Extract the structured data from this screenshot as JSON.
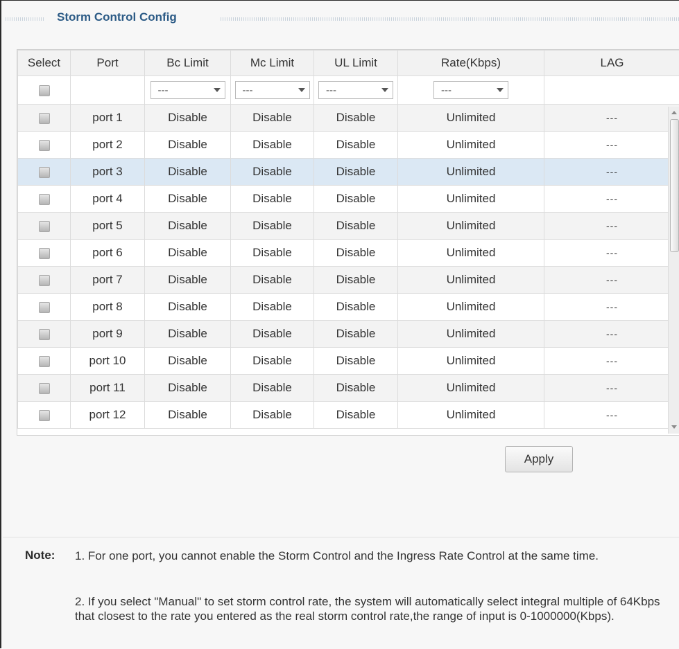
{
  "panel": {
    "title": "Storm Control Config"
  },
  "table": {
    "headers": [
      "Select",
      "Port",
      "Bc Limit",
      "Mc Limit",
      "UL Limit",
      "Rate(Kbps)",
      "LAG"
    ],
    "filter": {
      "bc": "---",
      "mc": "---",
      "ul": "---",
      "rate": "---"
    },
    "rows": [
      {
        "port": "port 1",
        "bc": "Disable",
        "mc": "Disable",
        "ul": "Disable",
        "rate": "Unlimited",
        "lag": "---"
      },
      {
        "port": "port 2",
        "bc": "Disable",
        "mc": "Disable",
        "ul": "Disable",
        "rate": "Unlimited",
        "lag": "---"
      },
      {
        "port": "port 3",
        "bc": "Disable",
        "mc": "Disable",
        "ul": "Disable",
        "rate": "Unlimited",
        "lag": "---"
      },
      {
        "port": "port 4",
        "bc": "Disable",
        "mc": "Disable",
        "ul": "Disable",
        "rate": "Unlimited",
        "lag": "---"
      },
      {
        "port": "port 5",
        "bc": "Disable",
        "mc": "Disable",
        "ul": "Disable",
        "rate": "Unlimited",
        "lag": "---"
      },
      {
        "port": "port 6",
        "bc": "Disable",
        "mc": "Disable",
        "ul": "Disable",
        "rate": "Unlimited",
        "lag": "---"
      },
      {
        "port": "port 7",
        "bc": "Disable",
        "mc": "Disable",
        "ul": "Disable",
        "rate": "Unlimited",
        "lag": "---"
      },
      {
        "port": "port 8",
        "bc": "Disable",
        "mc": "Disable",
        "ul": "Disable",
        "rate": "Unlimited",
        "lag": "---"
      },
      {
        "port": "port 9",
        "bc": "Disable",
        "mc": "Disable",
        "ul": "Disable",
        "rate": "Unlimited",
        "lag": "---"
      },
      {
        "port": "port 10",
        "bc": "Disable",
        "mc": "Disable",
        "ul": "Disable",
        "rate": "Unlimited",
        "lag": "---"
      },
      {
        "port": "port 11",
        "bc": "Disable",
        "mc": "Disable",
        "ul": "Disable",
        "rate": "Unlimited",
        "lag": "---"
      },
      {
        "port": "port 12",
        "bc": "Disable",
        "mc": "Disable",
        "ul": "Disable",
        "rate": "Unlimited",
        "lag": "---"
      }
    ]
  },
  "apply_label": "Apply",
  "note": {
    "label": "Note:",
    "item1": "1. For one port, you cannot enable the Storm Control and the Ingress Rate Control at the same time.",
    "item2": "2. If you select \"Manual\" to set storm control rate, the system will automatically select integral multiple of 64Kbps that closest to the rate you entered as the real storm control rate,the range of input is 0-1000000(Kbps)."
  },
  "colors": {
    "title": "#2c5b86",
    "selected_row": "#dbe8f4",
    "alt_row": "#f3f3f3"
  }
}
